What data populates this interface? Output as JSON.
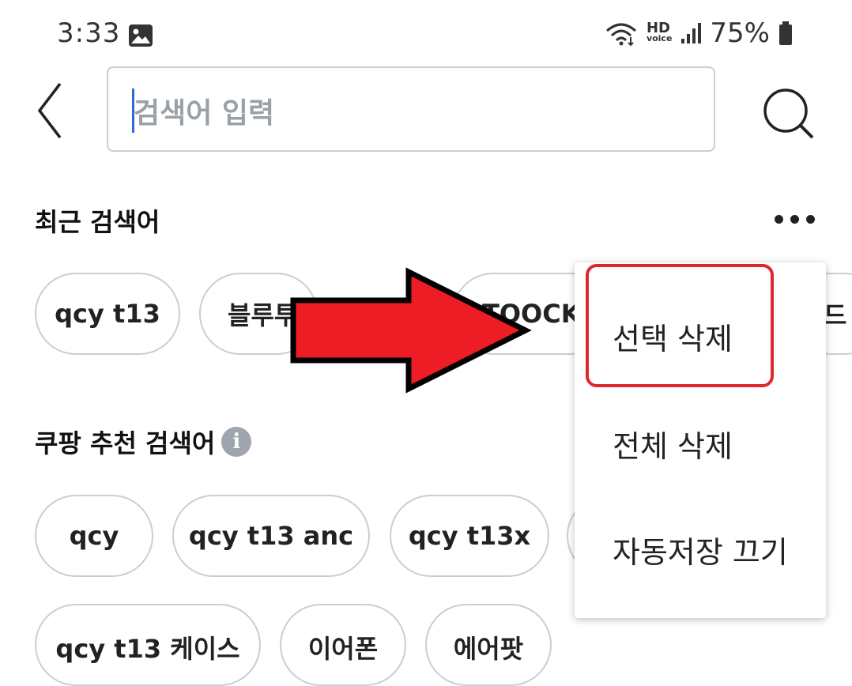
{
  "status_bar": {
    "time": "3:33",
    "battery": "75%",
    "hd_label": "HD",
    "voice_label": "voice",
    "icons": [
      "image-icon",
      "wifi-icon",
      "signal-icon",
      "battery-icon"
    ]
  },
  "search": {
    "placeholder": "검색어 입력"
  },
  "recent": {
    "title": "최근 검색어",
    "chips": [
      "qcy t13",
      "블루투",
      "TOOCKI",
      "드"
    ]
  },
  "recommended": {
    "title": "쿠팡 추천 검색어",
    "info_icon": "i",
    "chips_row1": [
      "qcy",
      "qcy t13 anc",
      "qcy t13x"
    ],
    "chips_row2": [
      "qcy t13 케이스",
      "이어폰",
      "에어팟"
    ]
  },
  "menu": {
    "items": [
      "선택 삭제",
      "전체 삭제",
      "자동저장 끄기"
    ]
  },
  "colors": {
    "accent_red": "#e0262f",
    "arrow_red": "#ee1c25",
    "caret_blue": "#2a6cd6",
    "chip_border": "#c9ced4"
  }
}
